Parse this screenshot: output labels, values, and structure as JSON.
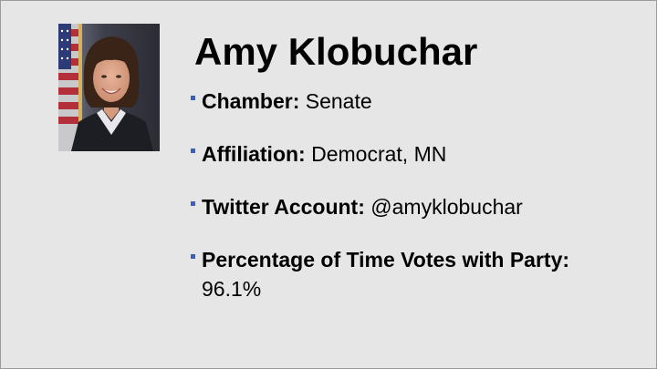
{
  "slide": {
    "title": "Amy Klobuchar",
    "portrait_icon": "portrait-photo",
    "bullet_color": "#3a5fbf",
    "background_color": "#e6e6e6",
    "facts": [
      {
        "label": "Chamber:",
        "value": "Senate"
      },
      {
        "label": "Affiliation:",
        "value": "Democrat, MN"
      },
      {
        "label": "Twitter Account:",
        "value": "@amyklobuchar"
      },
      {
        "label": "Percentage of Time Votes with Party:",
        "value": "96.1%"
      }
    ]
  }
}
